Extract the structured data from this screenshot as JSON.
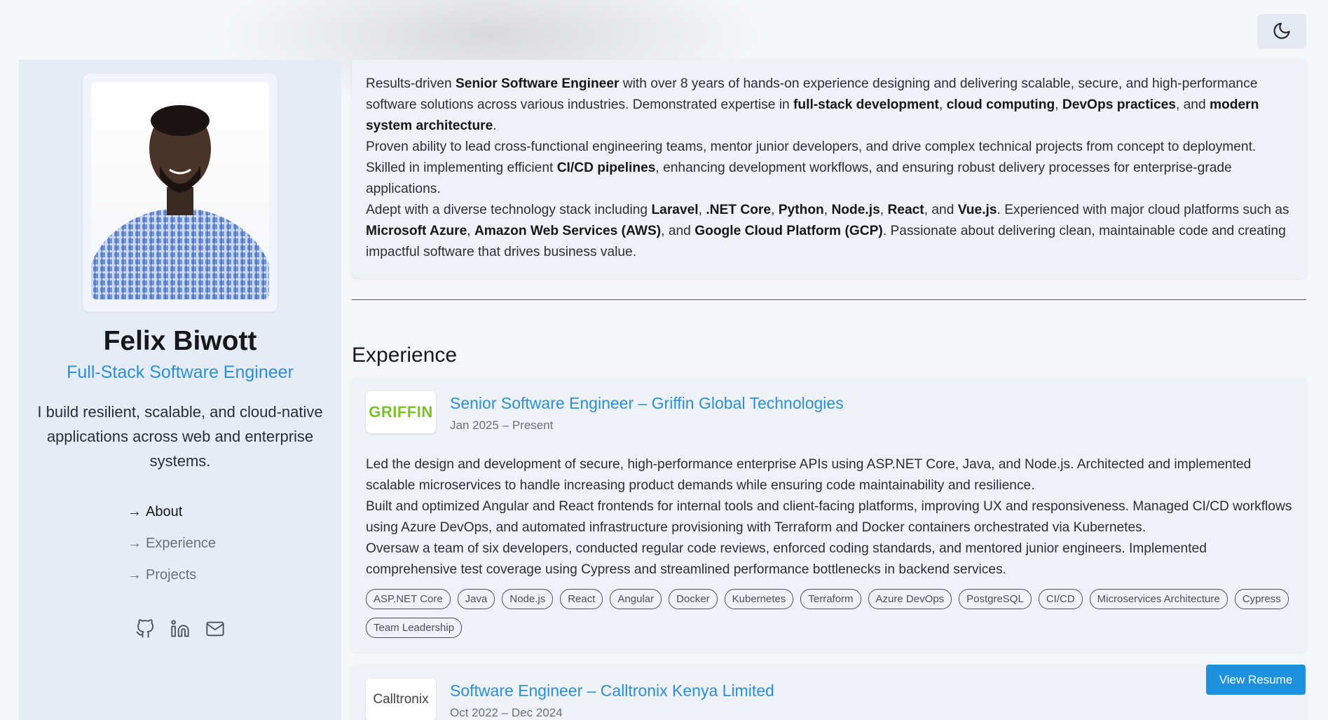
{
  "theme_toggle": {
    "icon": "moon-icon"
  },
  "profile": {
    "name": "Felix Biwott",
    "role": "Full-Stack Software Engineer",
    "tagline": "I build resilient, scalable, and cloud-native applications across web and enterprise systems."
  },
  "nav": {
    "items": [
      {
        "arrow": "→",
        "label": "About"
      },
      {
        "arrow": "→",
        "label": "Experience"
      },
      {
        "arrow": "→",
        "label": "Projects"
      }
    ]
  },
  "socials": [
    "github-icon",
    "linkedin-icon",
    "mail-icon"
  ],
  "about": {
    "p1_a": "Results-driven ",
    "p1_b": "Senior Software Engineer",
    "p1_c": " with over 8 years of hands-on experience designing and delivering scalable, secure, and high-performance software solutions across various industries. Demonstrated expertise in ",
    "p1_d": "full-stack development",
    "p1_e": ", ",
    "p1_f": "cloud computing",
    "p1_g": ", ",
    "p1_h": "DevOps practices",
    "p1_i": ", and ",
    "p1_j": "modern system architecture",
    "p1_k": ".",
    "p2_a": "Proven ability to lead cross-functional engineering teams, mentor junior developers, and drive complex technical projects from concept to deployment. Skilled in implementing efficient ",
    "p2_b": "CI/CD pipelines",
    "p2_c": ", enhancing development workflows, and ensuring robust delivery processes for enterprise-grade applications.",
    "p3_a": "Adept with a diverse technology stack including ",
    "p3_b": "Laravel",
    "p3_c": ", ",
    "p3_d": ".NET Core",
    "p3_e": ", ",
    "p3_f": "Python",
    "p3_g": ", ",
    "p3_h": "Node.js",
    "p3_i": ", ",
    "p3_j": "React",
    "p3_k": ", and ",
    "p3_l": "Vue.js",
    "p3_m": ". Experienced with major cloud platforms such as ",
    "p3_n": "Microsoft Azure",
    "p3_o": ", ",
    "p3_p": "Amazon Web Services (AWS)",
    "p3_q": ", and ",
    "p3_r": "Google Cloud Platform (GCP)",
    "p3_s": ". Passionate about delivering clean, maintainable code and creating impactful software that drives business value."
  },
  "experience": {
    "heading": "Experience",
    "jobs": [
      {
        "logo_text": "GRIFFIN",
        "title": "Senior Software Engineer – Griffin Global Technologies",
        "dates": "Jan 2025 – Present",
        "desc1": "Led the design and development of secure, high-performance enterprise APIs using ASP.NET Core, Java, and Node.js. Architected and implemented scalable microservices to handle increasing product demands while ensuring code maintainability and resilience.",
        "desc2": "Built and optimized Angular and React frontends for internal tools and client-facing platforms, improving UX and responsiveness. Managed CI/CD workflows using Azure DevOps, and automated infrastructure provisioning with Terraform and Docker containers orchestrated via Kubernetes.",
        "desc3": "Oversaw a team of six developers, conducted regular code reviews, enforced coding standards, and mentored junior engineers. Implemented comprehensive test coverage using Cypress and streamlined performance bottlenecks in backend services.",
        "tags": [
          "ASP.NET Core",
          "Java",
          "Node.js",
          "React",
          "Angular",
          "Docker",
          "Kubernetes",
          "Terraform",
          "Azure DevOps",
          "PostgreSQL",
          "CI/CD",
          "Microservices Architecture",
          "Cypress",
          "Team Leadership"
        ]
      },
      {
        "logo_text": "Calltronix",
        "title": "Software Engineer – Calltronix Kenya Limited",
        "dates": "Oct 2022 – Dec 2024"
      }
    ]
  },
  "resume_button": "View Resume",
  "colors": {
    "accent": "#1e90e0",
    "link": "#2a8fd6",
    "sidebar_bg": "#e6ecf6",
    "card_bg": "#eef1f6",
    "logo_green": "#7cbf2f"
  }
}
